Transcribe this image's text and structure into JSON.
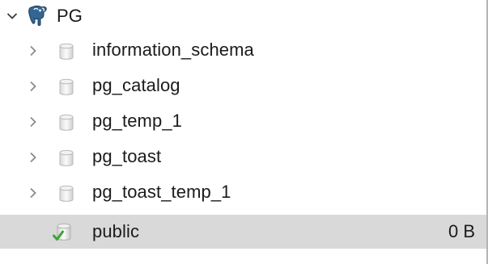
{
  "tree": {
    "root": {
      "label": "PG",
      "icon": "postgresql-elephant-icon",
      "expanded": true
    },
    "schemas": [
      {
        "label": "information_schema",
        "icon": "schema-cylinder-icon",
        "expanded": false,
        "size": ""
      },
      {
        "label": "pg_catalog",
        "icon": "schema-cylinder-icon",
        "expanded": false,
        "size": ""
      },
      {
        "label": "pg_temp_1",
        "icon": "schema-cylinder-icon",
        "expanded": false,
        "size": ""
      },
      {
        "label": "pg_toast",
        "icon": "schema-cylinder-icon",
        "expanded": false,
        "size": ""
      },
      {
        "label": "pg_toast_temp_1",
        "icon": "schema-cylinder-icon",
        "expanded": false,
        "size": ""
      },
      {
        "label": "public",
        "icon": "active-schema-icon",
        "expanded": false,
        "size": "0 B",
        "selected": true
      }
    ]
  },
  "colors": {
    "selection": "#d9d9d9",
    "chevron": "#7a7a7a",
    "elephant": "#336791",
    "active_check": "#3fa535"
  }
}
